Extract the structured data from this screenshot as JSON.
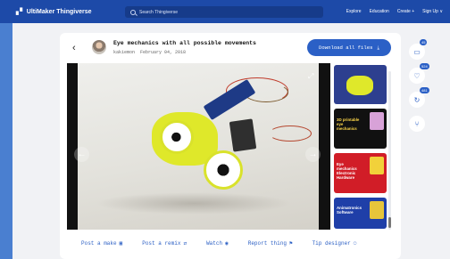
{
  "topbar": {
    "brand": "UltiMaker Thingiverse",
    "search_placeholder": "Search Thingiverse",
    "nav": [
      "Explore",
      "Education",
      "Create +",
      "Sign Up ∨"
    ]
  },
  "thing": {
    "title": "Eye mechanics with all possible movements",
    "author": "kakiemon",
    "date": "February 04, 2018",
    "download_label": "Download all files"
  },
  "thumbnails": [
    {
      "caption": ""
    },
    {
      "caption": "3D printable eye mechanics"
    },
    {
      "caption": "Eye mechanics Electronic Hardware"
    },
    {
      "caption": "Animatronics Software"
    }
  ],
  "actions": [
    "Post a make",
    "Post a remix",
    "Watch",
    "Report thing",
    "Tip designer"
  ],
  "side_counts": {
    "comments": "45",
    "likes": "524",
    "remixes": "481"
  },
  "colors": {
    "topbar": "#1d4aa8",
    "accent": "#2b60c6",
    "background": "#f1f2f5"
  }
}
